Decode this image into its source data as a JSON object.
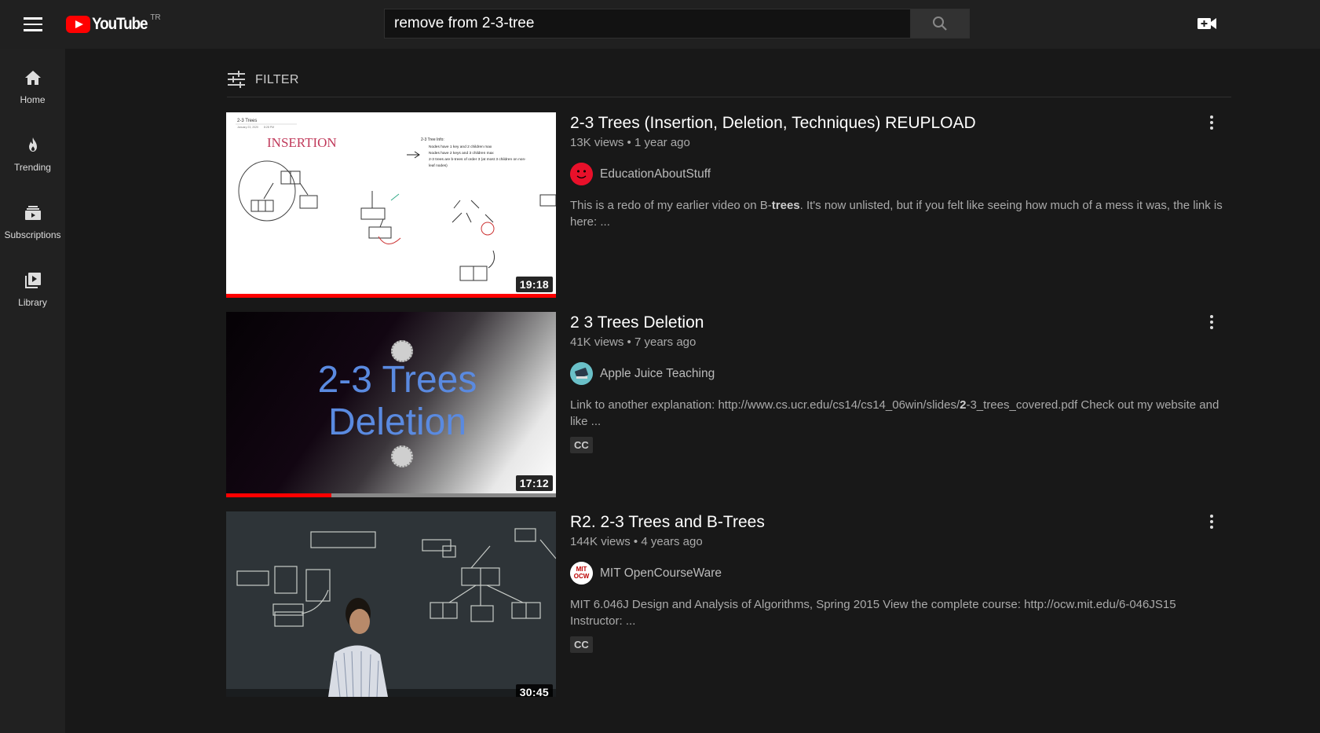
{
  "header": {
    "menu_icon": "hamburger-menu-icon",
    "logo_text": "YouTube",
    "country_code": "TR",
    "search_value": "remove from 2-3-tree",
    "search_icon": "search-icon",
    "create_icon": "video-camera-plus-icon",
    "brand_color": "#ff0000"
  },
  "sidebar": {
    "items": [
      {
        "label": "Home",
        "icon": "home-icon"
      },
      {
        "label": "Trending",
        "icon": "flame-icon"
      },
      {
        "label": "Subscriptions",
        "icon": "subscriptions-icon"
      },
      {
        "label": "Library",
        "icon": "library-icon"
      }
    ]
  },
  "filter": {
    "label": "FILTER",
    "icon": "filter-sliders-icon"
  },
  "results": [
    {
      "title": "2-3 Trees (Insertion, Deletion, Techniques) REUPLOAD",
      "views": "13K views",
      "age": "1 year ago",
      "channel": "EducationAboutStuff",
      "description_pre": "This is a redo of my earlier video on B-",
      "description_bold": "trees",
      "description_post": ". It's now unlisted, but if you felt like seeing how much of a mess it was, the link is here: ...",
      "duration": "19:18",
      "watched_fraction": 1.0,
      "thumb_text": {
        "heading": "2-3 Trees",
        "date": "January 23, 2020",
        "time": "8:28 PM",
        "insertion": "INSERTION",
        "info_title": "2-3 Tree Info:",
        "info_1": "Nodes have 1 key and 2 children max",
        "info_2": "Nodes have 2 keys and 3 children max",
        "info_3": "2-3 trees are b-trees of order 3 (at most 3 children on non-",
        "info_4": "leaf nodes)"
      },
      "cc": ""
    },
    {
      "title": "2 3 Trees Deletion",
      "views": "41K views",
      "age": "7 years ago",
      "channel": "Apple Juice Teaching",
      "description_pre": "Link to another explanation: http://www.cs.ucr.edu/cs14/cs14_06win/slides/",
      "description_bold": "2",
      "description_post": "-3_trees_covered.pdf Check out my website and like ...",
      "duration": "17:12",
      "watched_fraction": 0.32,
      "thumb_text": {
        "line1": "2-3 Trees",
        "line2": "Deletion"
      },
      "cc": "CC"
    },
    {
      "title": "R2. 2-3 Trees and B-Trees",
      "views": "144K views",
      "age": "4 years ago",
      "channel": "MIT OpenCourseWare",
      "channel_avatar_text": "MIT\nOCW",
      "description_pre": "MIT 6.046J Design and Analysis of Algorithms, Spring 2015 View the complete course: http://ocw.mit.edu/6-046JS15 Instructor: ...",
      "description_bold": "",
      "description_post": "",
      "duration": "30:45",
      "watched_fraction": 0,
      "cc": "CC"
    }
  ]
}
